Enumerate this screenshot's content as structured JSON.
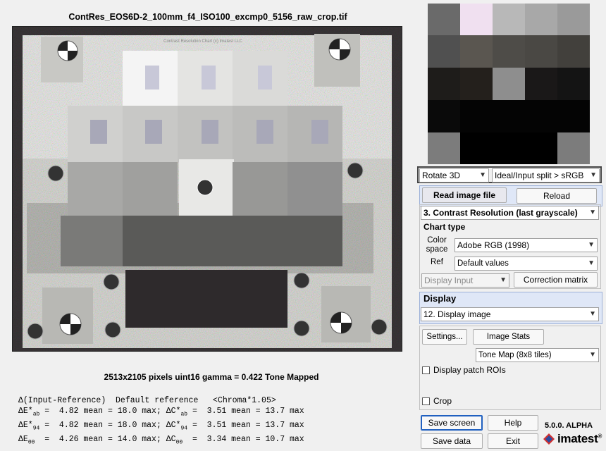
{
  "window": {
    "image_title": "ContRes_EOS6D-2_100mm_f4_ISO100_excmp0_5156_raw_crop.tif",
    "chart_watermark": "Contrast Resolution Chart (c) Imatest LLC",
    "image_info": "2513x2105 pixels    uint16    gamma = 0.422   Tone Mapped"
  },
  "stats": {
    "header": "Δ(Input-Reference)  Default reference   <Chroma*1.05>",
    "row1": "ΔE*ab  =  4.82 mean = 18.0 max; ΔC*ab  =  3.51 mean = 13.7 max",
    "row2": "ΔE*94  =  4.82 mean = 18.0 max; ΔC*94  =  3.51 mean = 13.7 max",
    "row3": "ΔE00  =  4.26 mean = 14.0 max; ΔC00  =  3.34 mean = 10.7 max",
    "l1a": "ΔE*",
    "l1s": "ab",
    "l1b": " =  4.82 mean = 18.0 max; ΔC*",
    "l1s2": "ab",
    "l1c": " =  3.51 mean = 13.7 max",
    "l2a": "ΔE*",
    "l2s": "94",
    "l2b": " =  4.82 mean = 18.0 max; ΔC*",
    "l2s2": "94",
    "l2c": " =  3.51 mean = 13.7 max",
    "l3a": "ΔE",
    "l3s": "00",
    "l3b": "  =  4.26 mean = 14.0 max; ΔC",
    "l3s2": "00",
    "l3c": "  =  3.34 mean = 10.7 max"
  },
  "controls": {
    "rotate": "Rotate 3D",
    "split": "Ideal/Input split > sRGB",
    "read_image": "Read image file",
    "reload": "Reload",
    "chart_select": "3.  Contrast Resolution  (last grayscale)",
    "chart_type_label": "Chart type",
    "color_space_label": "Color space",
    "color_space": "Adobe RGB (1998)",
    "ref_label": "Ref",
    "ref": "Default values",
    "display_input": "Display Input",
    "correction_matrix": "Correction matrix",
    "display_label": "Display",
    "display_select": "12. Display image",
    "settings": "Settings...",
    "image_stats": "Image Stats",
    "tone_map": "Tone Map (8x8 tiles)",
    "display_rois": "Display patch ROIs",
    "crop": "Crop",
    "save_screen": "Save screen",
    "help": "Help",
    "save_data": "Save data",
    "exit": "Exit",
    "version": "5.0.0. ALPHA",
    "brand": "imatest"
  }
}
